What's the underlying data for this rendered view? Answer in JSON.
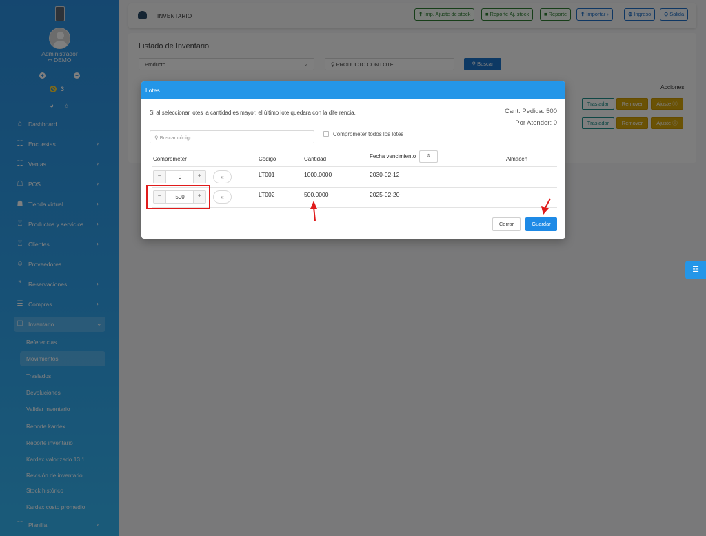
{
  "sidebar": {
    "user_name": "Administrador",
    "company": "∞ DEMO",
    "notification_count": "3",
    "nav": [
      {
        "icon": "⌂",
        "label": "Dashboard",
        "chevron": ""
      },
      {
        "icon": "☷",
        "label": "Encuestas",
        "chevron": "›"
      },
      {
        "icon": "☷",
        "label": "Ventas",
        "chevron": "›"
      },
      {
        "icon": "☖",
        "label": "POS",
        "chevron": "›"
      },
      {
        "icon": "☗",
        "label": "Tienda virtual",
        "chevron": "›"
      },
      {
        "icon": "♖",
        "label": "Productos y servicios",
        "chevron": "›"
      },
      {
        "icon": "♖",
        "label": "Clientes",
        "chevron": "›"
      },
      {
        "icon": "☺",
        "label": "Proveedores",
        "chevron": ""
      },
      {
        "icon": "❞",
        "label": "Reservaciones",
        "chevron": "›"
      },
      {
        "icon": "☰",
        "label": "Compras",
        "chevron": "›"
      },
      {
        "icon": "☐",
        "label": "Inventario",
        "chevron": "⌄"
      }
    ],
    "sub": [
      "Referencias",
      "Movimientos",
      "Traslados",
      "Devoluciones",
      "Validar inventario",
      "Reporte kardex",
      "Reporte inventario",
      "Kardex valorizado 13.1",
      "Revisión de inventario",
      "Stock histórico",
      "Kardex costo promedio"
    ],
    "last_nav": {
      "icon": "☷",
      "label": "Planilla",
      "chevron": "›"
    }
  },
  "topbar": {
    "title": "INVENTARIO",
    "buttons": [
      {
        "icon": "⬆",
        "label": "Imp. Ajuste de stock"
      },
      {
        "icon": "■",
        "label": "Reporte Aj. stock"
      },
      {
        "icon": "■",
        "label": "Reporte"
      },
      {
        "icon": "⬆",
        "label": "Importar ›"
      },
      {
        "icon": "⊕",
        "label": "Ingreso"
      },
      {
        "icon": "⊖",
        "label": "Salida"
      }
    ]
  },
  "main": {
    "title": "Listado de Inventario",
    "filter_select": "Producto",
    "search_value": "PRODUCTO CON LOTE",
    "search_button": "Buscar",
    "acciones_header": "Acciones",
    "row_buttons": {
      "trasladar": "Trasladar",
      "remover": "Remover",
      "ajuste": "Ajuste"
    }
  },
  "modal": {
    "title": "Lotes",
    "message": "Si al seleccionar lotes la cantidad es mayor, el último lote quedara con la dife rencia.",
    "cant_pedida": "Cant. Pedida: 500",
    "por_atender": "Por Atender: 0",
    "search_placeholder": "Buscar código ...",
    "comprometer_todos": "Comprometer todos los lotes",
    "headers": {
      "comprometer": "Comprometer",
      "codigo": "Código",
      "cantidad": "Cantidad",
      "fecha": "Fecha vencimiento",
      "almacen": "Almacén"
    },
    "rows": [
      {
        "comprometer": "0",
        "codigo": "LT001",
        "cantidad": "1000.0000",
        "fecha": "2030-02-12",
        "almacen": ""
      },
      {
        "comprometer": "500",
        "codigo": "LT002",
        "cantidad": "500.0000",
        "fecha": "2025-02-20",
        "almacen": ""
      }
    ],
    "btn_cerrar": "Cerrar",
    "btn_guardar": "Guardar"
  },
  "colors": {
    "sidebar": "#2a8fe0",
    "modal_header": "#2496e8",
    "primary": "#1e8ae6",
    "annotation": "#e01b1b",
    "warning": "#d4a409"
  }
}
